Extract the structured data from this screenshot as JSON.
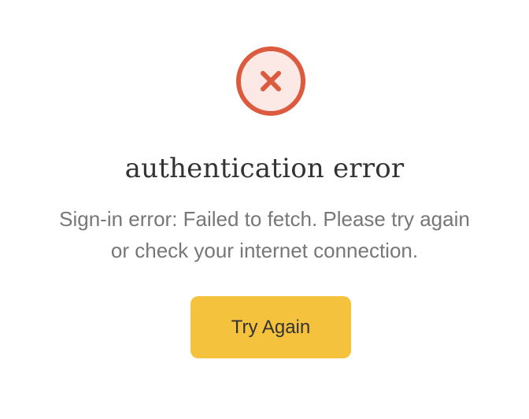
{
  "error": {
    "icon": "close-x-icon",
    "title": "authentication error",
    "message_line1": "Sign-in error: Failed to fetch. Please try again",
    "message_line2": "or check your internet connection.",
    "button_label": "Try Again"
  },
  "colors": {
    "icon_border": "#dc5a3d",
    "icon_fill": "#fce9e5",
    "button_bg": "#f4c23c",
    "title_text": "#333333",
    "message_text": "#777777"
  }
}
